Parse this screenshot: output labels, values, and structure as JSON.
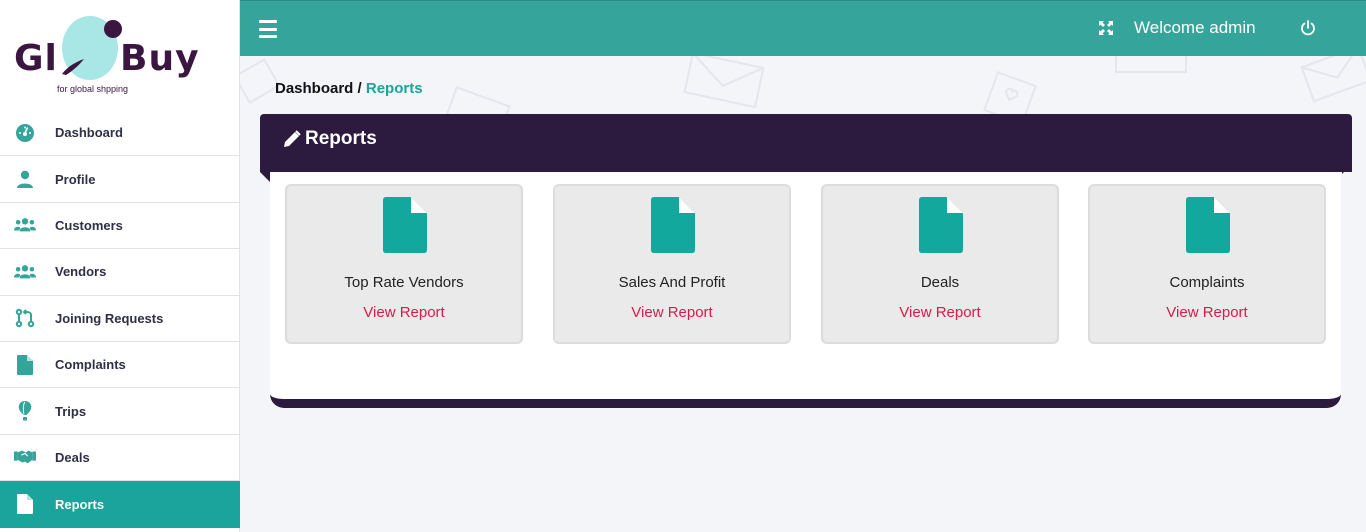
{
  "logo": {
    "word_left": "Gl",
    "word_right": "Buy",
    "tagline": "for global shpping"
  },
  "sidebar": {
    "items": [
      {
        "label": "Dashboard",
        "icon": "dashboard-gauge-icon",
        "active": false
      },
      {
        "label": "Profile",
        "icon": "user-icon",
        "active": false
      },
      {
        "label": "Customers",
        "icon": "users-icon",
        "active": false
      },
      {
        "label": "Vendors",
        "icon": "users-icon",
        "active": false
      },
      {
        "label": "Joining Requests",
        "icon": "git-pull-request-icon",
        "active": false
      },
      {
        "label": "Complaints",
        "icon": "file-icon",
        "active": false
      },
      {
        "label": "Trips",
        "icon": "hot-air-balloon-icon",
        "active": false
      },
      {
        "label": "Deals",
        "icon": "handshake-icon",
        "active": false
      },
      {
        "label": "Reports",
        "icon": "file-icon",
        "active": true
      }
    ]
  },
  "topbar": {
    "welcome": "Welcome admin"
  },
  "breadcrumb": {
    "root": "Dashboard",
    "separator": " / ",
    "current": "Reports"
  },
  "panel": {
    "title": "Reports"
  },
  "reports": [
    {
      "title": "Top Rate Vendors",
      "link": "View Report"
    },
    {
      "title": "Sales And Profit",
      "link": "View Report"
    },
    {
      "title": "Deals",
      "link": "View Report"
    },
    {
      "title": "Complaints",
      "link": "View Report"
    }
  ],
  "colors": {
    "accent": "#1aa49b",
    "topbar": "#35a59c",
    "panel_dark": "#2c1b3f",
    "link": "#d51c4a"
  }
}
